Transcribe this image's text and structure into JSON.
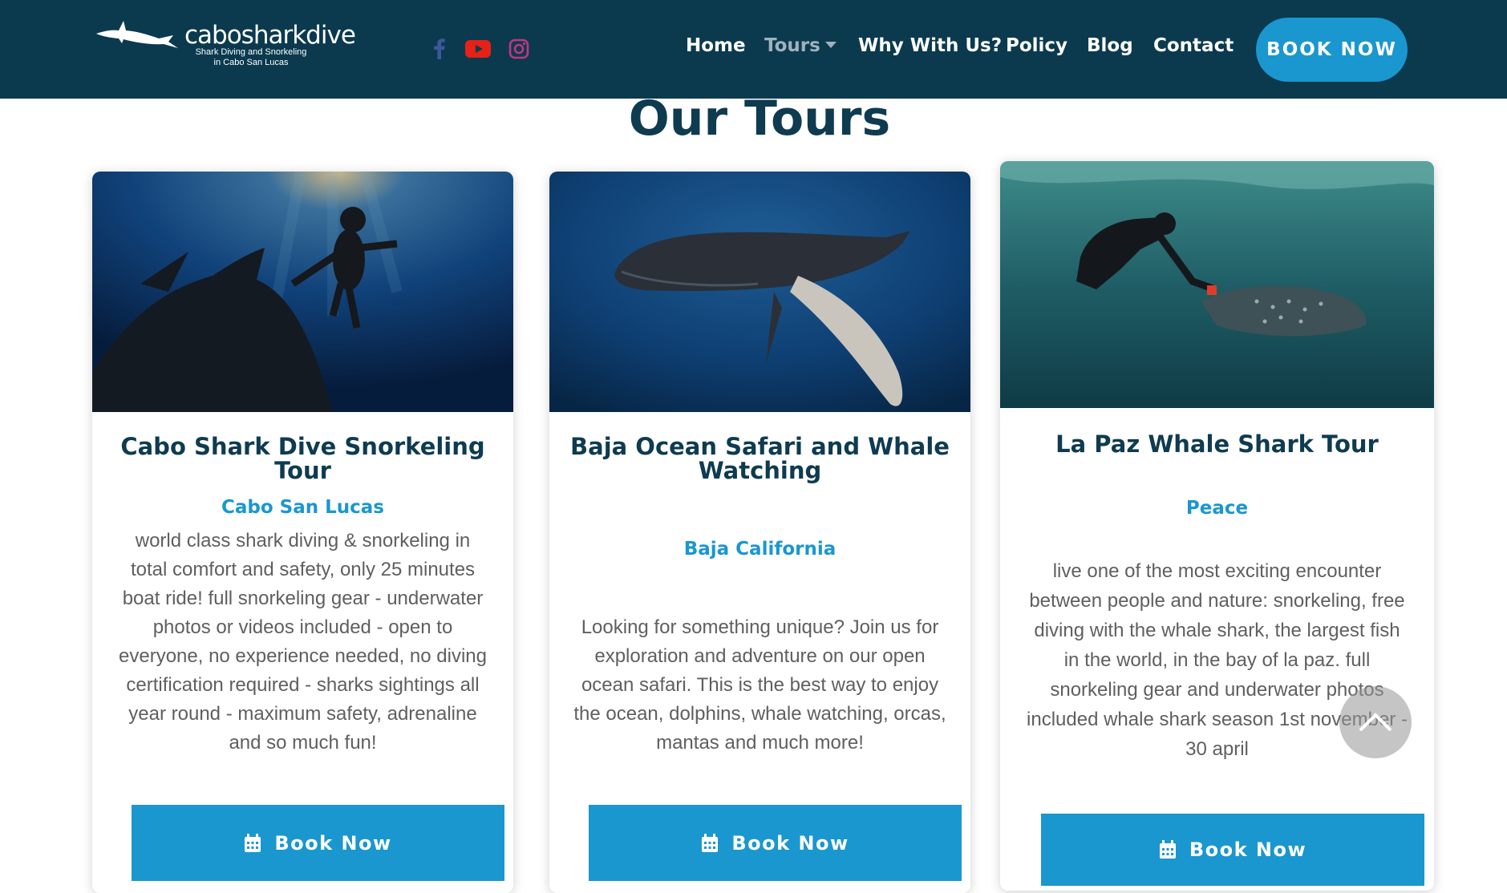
{
  "header": {
    "logo_name": "cabosharkdive",
    "logo_tagline": "Shark Diving and Snorkeling in Cabo San Lucas",
    "social": [
      {
        "name": "facebook-icon",
        "color": "#3b5998"
      },
      {
        "name": "youtube-icon",
        "color": "#e62117"
      },
      {
        "name": "instagram-icon",
        "color": "#c13584"
      }
    ],
    "nav": {
      "home": "Home",
      "tours": "Tours",
      "why": "Why With Us?",
      "policy": "Policy",
      "blog": "Blog",
      "contact": "Contact"
    },
    "book_now": "BOOK NOW",
    "colors": {
      "bar": "#0b3a4f",
      "accent": "#1a97cf"
    }
  },
  "main": {
    "title": "Our Tours",
    "cards": [
      {
        "title": "Cabo Shark Dive Snorkeling Tour",
        "location": "Cabo San Lucas",
        "description": "world class shark diving & snorkeling in total comfort and safety, only 25 minutes boat ride! full snorkeling gear - underwater photos or videos included - open to everyone, no experience needed, no diving certification required - sharks sightings all year round - maximum safety, adrenaline and so much fun!",
        "button": "Book Now"
      },
      {
        "title": "Baja Ocean Safari and Whale Watching",
        "location": "Baja California",
        "description": "Looking for something unique? Join us for exploration and adventure on our open ocean safari. This is the best way to enjoy the ocean, dolphins, whale watching, orcas, mantas and much more!",
        "button": "Book Now"
      },
      {
        "title": "La Paz Whale Shark Tour",
        "location": "Peace",
        "description": "live one of the most exciting encounter between people and nature: snorkeling, free diving with the whale shark, the largest fish in the world, in the bay of la paz. full snorkeling gear and underwater photos included whale shark season 1st november - 30 april",
        "button": "Book Now"
      }
    ]
  }
}
